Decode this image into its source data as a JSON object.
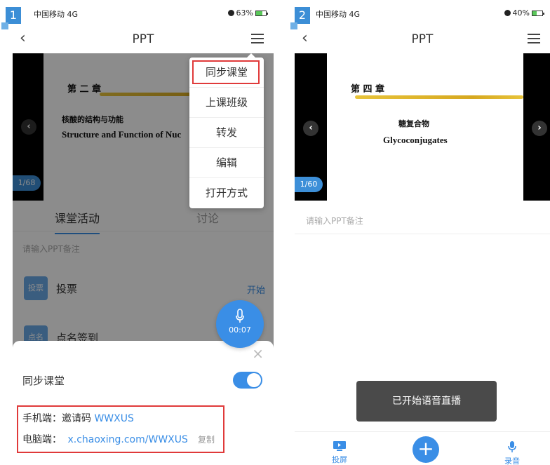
{
  "screen1": {
    "step": "1",
    "status": {
      "carrier": "中国移动 4G",
      "battery": "63%",
      "battery_level": 0.63
    },
    "nav": {
      "back": "‹",
      "title": "PPT"
    },
    "slide": {
      "chapter": "第 二 章",
      "subtitle_zh": "核酸的结构与功能",
      "subtitle_en": "Structure and Function of Nuc",
      "page": "1/68"
    },
    "tabs": [
      "课堂活动",
      "讨论"
    ],
    "note_placeholder": "请输入PPT备注",
    "activities": [
      {
        "icon": "投票",
        "name": "投票",
        "action": "开始"
      },
      {
        "icon": "点名",
        "name": "点名签到"
      }
    ],
    "dropdown": [
      "同步课堂",
      "上课班级",
      "转发",
      "编辑",
      "打开方式"
    ],
    "record": {
      "time": "00:07"
    },
    "sheet": {
      "close": "×",
      "sync_label": "同步课堂",
      "toggle_on": true,
      "mobile_label": "手机端：",
      "invite_label": "邀请码",
      "invite_code": "WWXUS",
      "pc_label": "电脑端：",
      "pc_link": "x.chaoxing.com/WWXUS",
      "copy": "复制"
    }
  },
  "screen2": {
    "step": "2",
    "status": {
      "carrier": "中国移动 4G",
      "battery": "40%",
      "battery_level": 0.4
    },
    "nav": {
      "back": "‹",
      "title": "PPT"
    },
    "slide": {
      "chapter": "第 四 章",
      "subtitle_zh": "糖复合物",
      "subtitle_en": "Glycoconjugates",
      "page": "1/60"
    },
    "note_placeholder": "请输入PPT备注",
    "toast": "已开始语音直播",
    "bottom": {
      "left": "投屏",
      "right": "录音"
    }
  },
  "colors": {
    "accent": "#3a8ee6",
    "highlight": "#e03a3a",
    "badge": "#3c8ed6"
  }
}
